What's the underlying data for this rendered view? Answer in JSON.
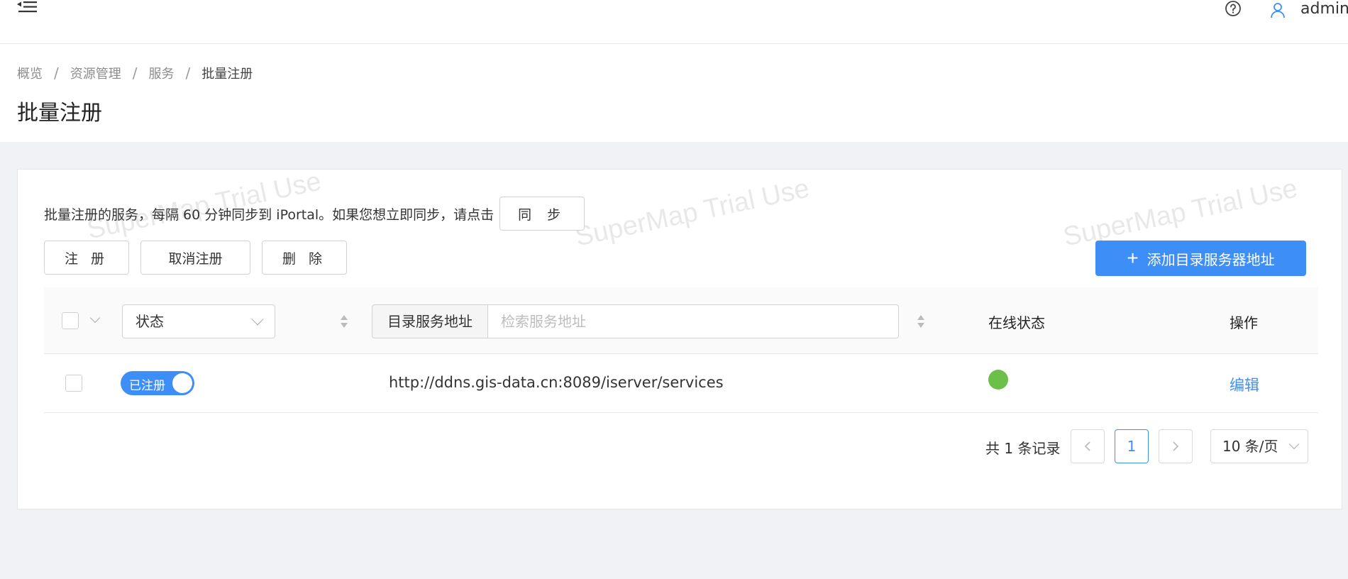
{
  "header": {
    "username": "admin"
  },
  "breadcrumb": [
    "概览",
    "资源管理",
    "服务",
    "批量注册"
  ],
  "page_title": "批量注册",
  "watermark": "SuperMap Trial Use",
  "sync": {
    "description": "批量注册的服务，每隔 60 分钟同步到 iPortal。如果您想立即同步，请点击",
    "button_label": "同 步"
  },
  "toolbar": {
    "register_label": "注 册",
    "unregister_label": "取消注册",
    "delete_label": "删 除",
    "add_label": "添加目录服务器地址"
  },
  "table": {
    "status_filter": "状态",
    "address_label": "目录服务地址",
    "search_placeholder": "检索服务地址",
    "online_status_header": "在线状态",
    "actions_header": "操作",
    "rows": [
      {
        "status_label": "已注册",
        "url": "http://ddns.gis-data.cn:8089/iserver/services",
        "action": "编辑",
        "online_color": "#6cc04a"
      }
    ]
  },
  "pagination": {
    "total_text": "共 1 条记录",
    "current_page": "1",
    "page_size": "10 条/页"
  },
  "colors": {
    "primary": "#3e8ef7",
    "online": "#6cc04a"
  }
}
